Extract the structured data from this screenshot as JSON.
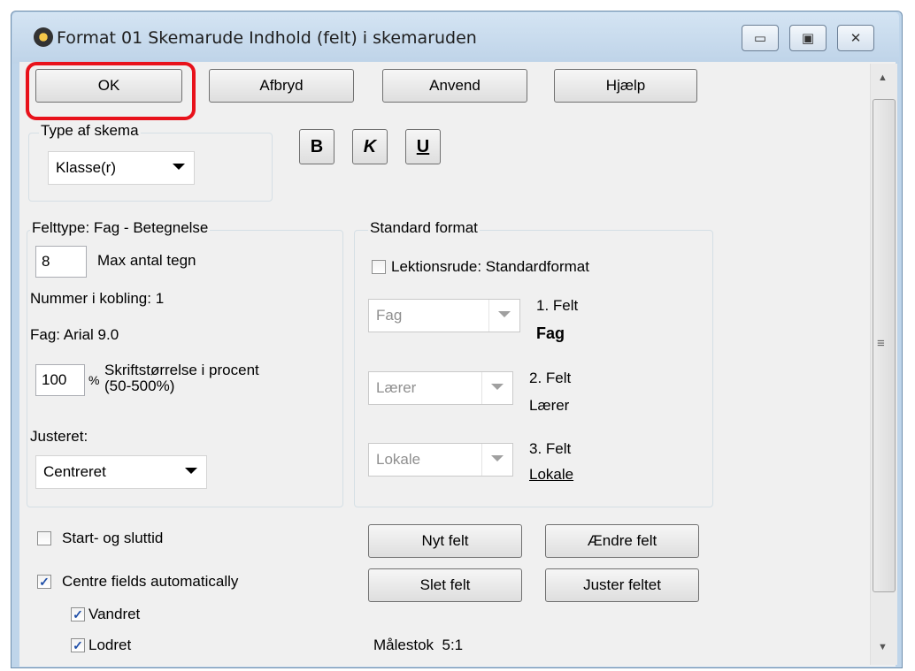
{
  "window": {
    "title": "Format 01  Skemarude  Indhold (felt) i skemaruden",
    "controls": {
      "minimize_icon": "minimize-icon",
      "maximize_icon": "maximize-icon",
      "close_icon": "close-icon"
    }
  },
  "toolbar": {
    "ok_label": "OK",
    "cancel_label": "Afbryd",
    "apply_label": "Anvend",
    "help_label": "Hjælp"
  },
  "schedule_type": {
    "legend": "Type af skema",
    "selected": "Klasse(r)"
  },
  "text_format": {
    "bold": "B",
    "italic": "K",
    "underline": "U"
  },
  "field_type": {
    "legend": "Felttype: Fag - Betegnelse",
    "max_chars_value": "8",
    "max_chars_label": "Max antal tegn",
    "link_number": "Nummer i kobling: 1",
    "font_info": "Fag: Arial 9.0",
    "font_size_value": "100",
    "percent_sign": "%",
    "font_size_label_line1": "Skriftstørrelse i procent",
    "font_size_label_line2": "(50-500%)",
    "align_label": "Justeret:",
    "align_selected": "Centreret"
  },
  "standard_format": {
    "legend": "Standard format",
    "lesson_cell_label": "Lektionsrude: Standardformat",
    "fields": [
      {
        "combo_value": "Fag",
        "title": "1. Felt",
        "preview": "Fag"
      },
      {
        "combo_value": "Lærer",
        "title": "2. Felt",
        "preview": "Lærer"
      },
      {
        "combo_value": "Lokale",
        "title": "3. Felt",
        "preview": "Lokale"
      }
    ]
  },
  "options": {
    "start_end_time": {
      "label": "Start- og sluttid",
      "checked": false
    },
    "centre_fields": {
      "label": "Centre fields automatically",
      "checked": true
    },
    "horizontal": {
      "label": "Vandret",
      "checked": true
    },
    "vertical": {
      "label": "Lodret",
      "checked": true
    }
  },
  "field_actions": {
    "new_field": "Nyt felt",
    "change_field": "Ændre felt",
    "delete_field": "Slet felt",
    "adjust_field": "Juster feltet"
  },
  "scale": {
    "label": "Målestok",
    "value": "5:1"
  },
  "colors": {
    "highlight": "#e8121b",
    "check": "#1f4fa8"
  }
}
